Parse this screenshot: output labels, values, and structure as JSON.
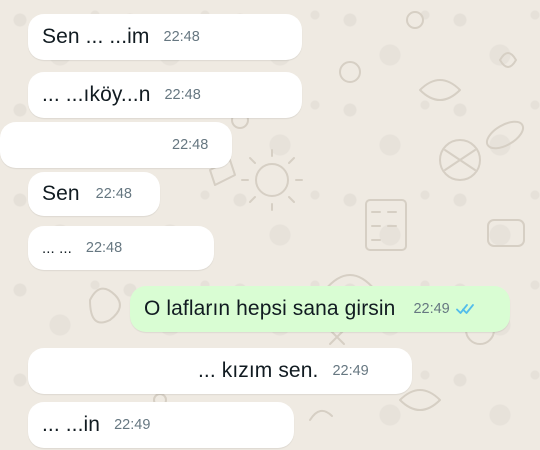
{
  "chat": {
    "messages": [
      {
        "id": "m1",
        "direction": "incoming",
        "text": "Sen ... ...im",
        "time": "22:48"
      },
      {
        "id": "m2",
        "direction": "incoming",
        "text": "... ...ıköy...n",
        "time": "22:48"
      },
      {
        "id": "m3",
        "direction": "incoming",
        "text": "",
        "time": "22:48"
      },
      {
        "id": "m4",
        "direction": "incoming",
        "text": "Sen",
        "time": "22:48"
      },
      {
        "id": "m5",
        "direction": "incoming",
        "text": "... ...",
        "time": "22:48"
      },
      {
        "id": "m6",
        "direction": "outgoing",
        "text": "O lafların hepsi sana girsin",
        "time": "22:49",
        "status": "read"
      },
      {
        "id": "m7",
        "direction": "incoming",
        "text": "... kızım sen.",
        "time": "22:49"
      },
      {
        "id": "m8",
        "direction": "incoming",
        "text": "... ...in",
        "time": "22:49"
      }
    ]
  },
  "colors": {
    "background": "#efeae2",
    "incoming_bubble": "#ffffff",
    "outgoing_bubble": "#d9fdd3",
    "read_ticks": "#53bdeb",
    "time_text": "#667781"
  },
  "icons": {
    "read_status": "double-check-icon"
  }
}
